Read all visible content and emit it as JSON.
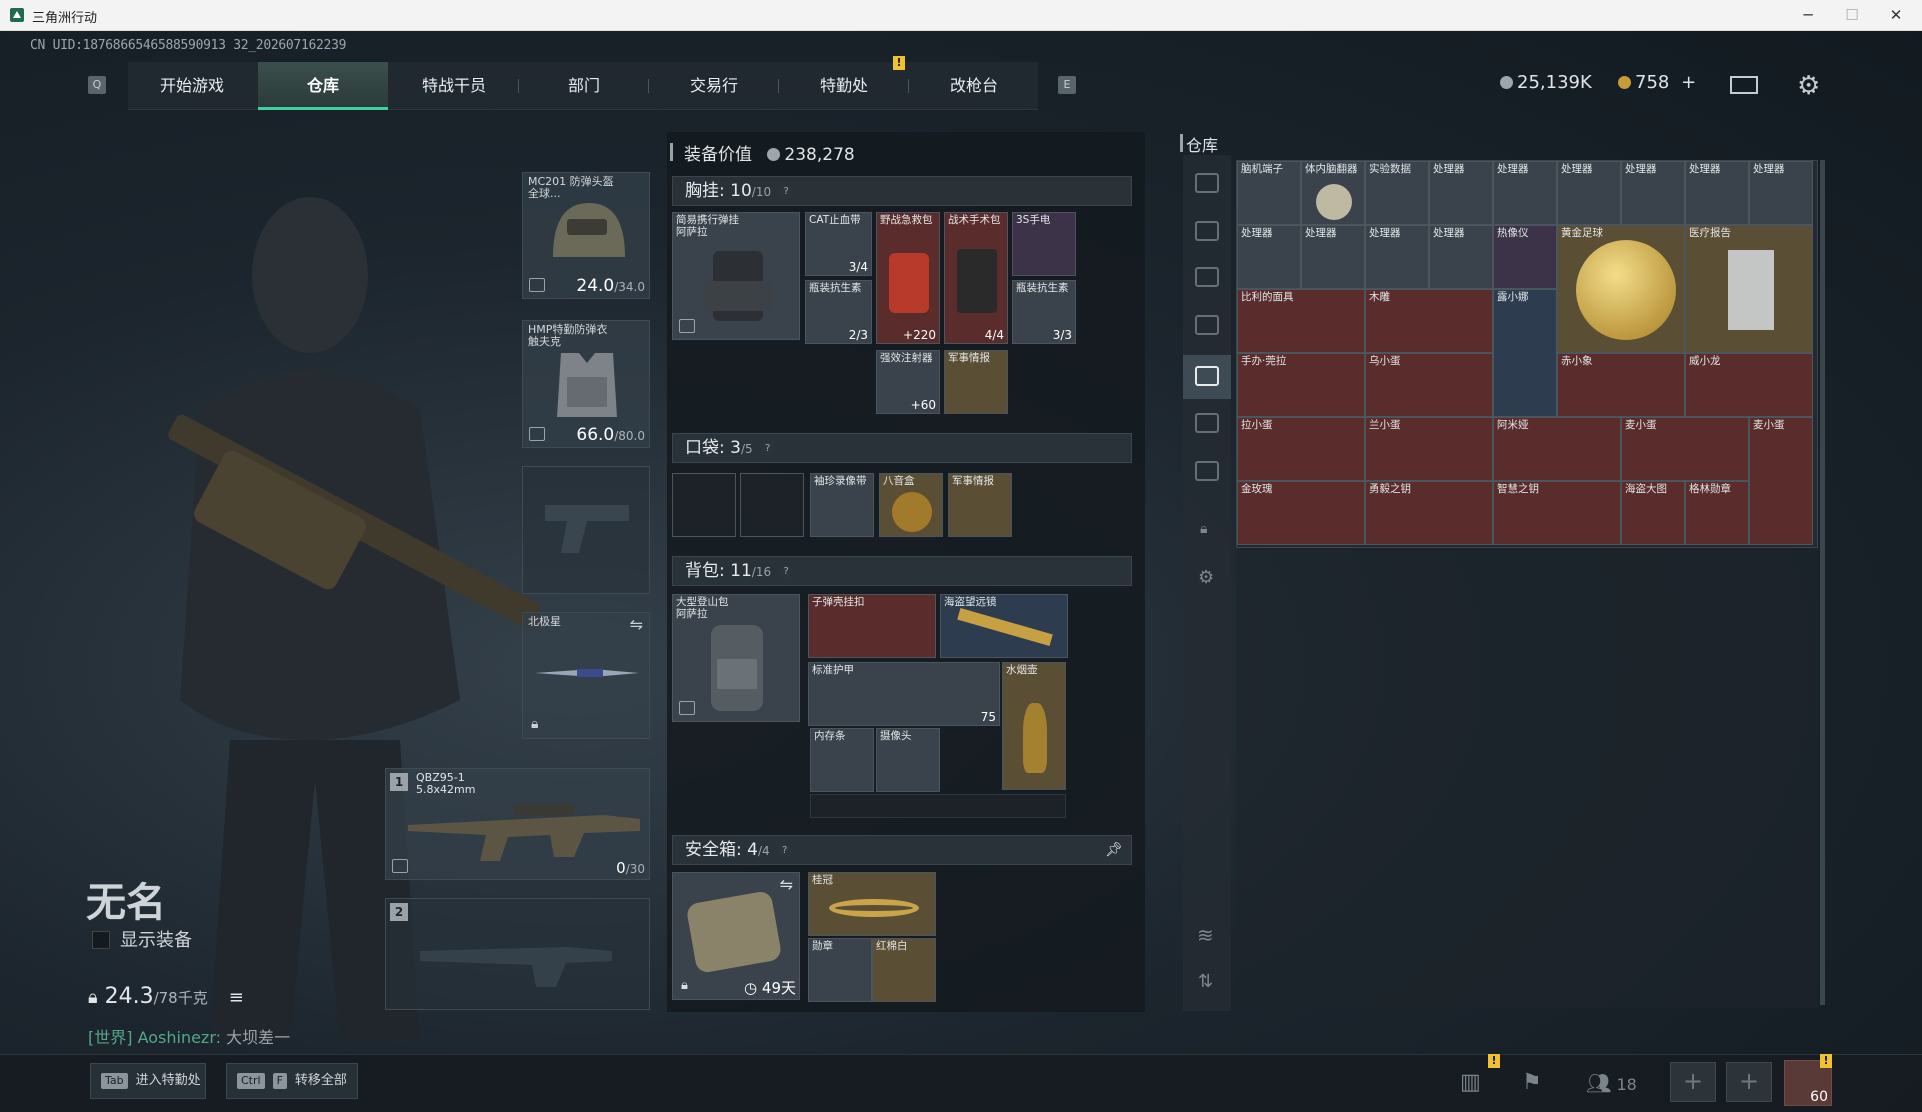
{
  "window": {
    "title": "三角洲行动"
  },
  "uid": "CN UID:1876866546588590913 32_202607162239",
  "nav": {
    "left_key": "Q",
    "right_key": "E",
    "tabs": [
      "开始游戏",
      "仓库",
      "特战干员",
      "部门",
      "交易行",
      "特勤处",
      "改枪台"
    ],
    "active": "仓库"
  },
  "currency": {
    "silver": "25,139K",
    "gold": "758",
    "plus": "+"
  },
  "character": {
    "name": "无名",
    "show_equipment": "显示装备",
    "weight": "24.3",
    "weight_max": "/78千克",
    "chat_channel": "[世界] Aoshinezr:",
    "chat_message": "大坝差一"
  },
  "slots": {
    "helmet": {
      "label": "MC201 防弹头盔\n全球...",
      "value": "24.0",
      "max": "/34.0"
    },
    "armor": {
      "label": "HMP特勤防弹衣\n触夫克",
      "value": "66.0",
      "max": "/80.0"
    },
    "melee": {
      "label": "北极星"
    },
    "primary": {
      "num": "1",
      "name": "QBZ95-1",
      "ammo": "5.8x42mm",
      "count": "0",
      "count_max": "/30"
    },
    "secondary": {
      "num": "2"
    }
  },
  "equipment": {
    "header": "装备价值",
    "value": "238,278",
    "chest": {
      "label": "胸挂:",
      "count": "10",
      "max": "/10"
    },
    "pocket": {
      "label": "口袋:",
      "count": "3",
      "max": "/5"
    },
    "backpack": {
      "label": "背包:",
      "count": "11",
      "max": "/16"
    },
    "safebox": {
      "label": "安全箱:",
      "count": "4",
      "max": "/4",
      "timer": "49天"
    }
  },
  "chest_items": [
    {
      "name": "简易携行弹挂\n阿萨拉",
      "cnt": ""
    },
    {
      "name": "CAT止血带",
      "cnt": "3/4"
    },
    {
      "name": "野战急救包",
      "cnt": "+220"
    },
    {
      "name": "战术手术包",
      "cnt": "4/4"
    },
    {
      "name": "3S手电",
      "cnt": ""
    },
    {
      "name": "瓶装抗生素",
      "cnt": "2/3"
    },
    {
      "name": "瓶装抗生素",
      "cnt": "3/3"
    },
    {
      "name": "强效注射器",
      "cnt": "+60"
    },
    {
      "name": "军事情报",
      "cnt": ""
    }
  ],
  "pocket_items": [
    {
      "name": "袖珍录像带"
    },
    {
      "name": "八音盒"
    },
    {
      "name": "军事情报"
    }
  ],
  "backpack_items": [
    {
      "name": "大型登山包\n阿萨拉"
    },
    {
      "name": "子弹壳挂扣"
    },
    {
      "name": "海盗望远镜"
    },
    {
      "name": "标准护甲",
      "cnt": "75"
    },
    {
      "name": "水烟壶"
    },
    {
      "name": "内存条"
    },
    {
      "name": "摄像头"
    }
  ],
  "safebox_items": [
    {
      "name": "桂冠"
    },
    {
      "name": "勋章"
    },
    {
      "name": "红棉白"
    }
  ],
  "warehouse": {
    "title": "仓库",
    "items": [
      "脑机端子",
      "体内脑翻器",
      "实验数据",
      "处理器",
      "处理器",
      "处理器",
      "处理器",
      "处理器",
      "处理器",
      "处理器",
      "处理器",
      "处理器",
      "处理器",
      "热像仪",
      "黄金足球",
      "医疗报告",
      "比利的面具",
      "木雕",
      "露小娜",
      "手办·莞拉",
      "乌小蛋",
      "赤小象",
      "威小龙",
      "拉小蛋",
      "兰小蛋",
      "阿米娅",
      "麦小蛋",
      "麦小蛋",
      "金玫瑰",
      "勇毅之钥",
      "智慧之钥",
      "海盗大图",
      "格林勋章"
    ]
  },
  "bottom": {
    "enter_btn": {
      "key": "Tab",
      "label": "进入特勤处"
    },
    "transfer_btn": {
      "key1": "Ctrl",
      "key2": "F",
      "label": "转移全部"
    },
    "friends": "18",
    "level": "60",
    "notif": "!"
  }
}
